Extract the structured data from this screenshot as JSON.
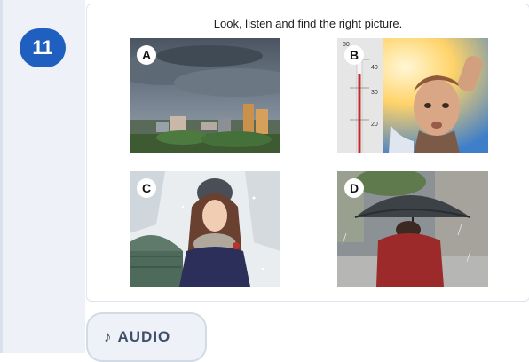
{
  "question": {
    "number": "11",
    "prompt": "Look, listen and find the right picture."
  },
  "options": [
    {
      "letter": "A",
      "image": "cloudy-city-skyline"
    },
    {
      "letter": "B",
      "image": "man-with-thermometer-hot"
    },
    {
      "letter": "C",
      "image": "woman-in-snow"
    },
    {
      "letter": "D",
      "image": "person-with-umbrella-rain"
    }
  ],
  "thermometer": {
    "ticks": [
      "50",
      "40",
      "30",
      "20"
    ]
  },
  "audio": {
    "icon": "music-note-icon",
    "label": "AUDIO",
    "glyph": "♪"
  },
  "colors": {
    "badge": "#1f5fbf",
    "gutter": "#eef2f8"
  }
}
